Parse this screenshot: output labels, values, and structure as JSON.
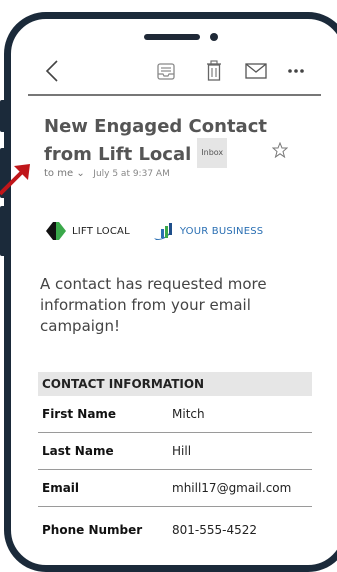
{
  "colors": {
    "phone_frame": "#1b2a3a",
    "subject_text": "#555555",
    "arrow": "#c0161a",
    "brand_blue": "#2a6fb3",
    "table_header_bg": "#e6e6e6"
  },
  "toolbar": {
    "icons": [
      "back-chevron-icon",
      "archive-icon",
      "trash-icon",
      "mail-icon",
      "more-icon"
    ]
  },
  "email": {
    "subject": "New Engaged Contact from Lift Local",
    "badge": "Inbox",
    "to": "to me",
    "date": "July 5 at 9:37 AM"
  },
  "logos": {
    "left": "LIFT LOCAL",
    "right": "YOUR BUSINESS"
  },
  "message": "A contact has requested more information from your email campaign!",
  "contact": {
    "header": "CONTACT INFORMATION",
    "rows": [
      {
        "label": "First Name",
        "value": "Mitch"
      },
      {
        "label": "Last Name",
        "value": "Hill"
      },
      {
        "label": "Email",
        "value": "mhill17@gmail.com"
      },
      {
        "label": "Phone Number",
        "value": "801-555-4522"
      }
    ]
  }
}
